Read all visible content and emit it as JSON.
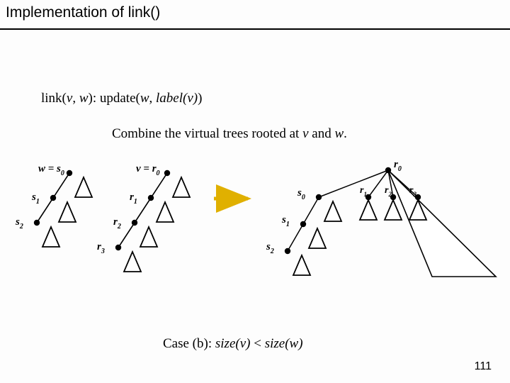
{
  "title_plain": "Implementation of ",
  "title_func": "link()",
  "line1": {
    "lhs": "link(",
    "v": "v",
    "sep1": ", ",
    "w": "w",
    "rhs1": "):  update(",
    "arg_w": "w",
    "sep2": ", ",
    "label_open": "label(",
    "arg_v": "v",
    "label_close": ")",
    "close": ")"
  },
  "line2": {
    "text1": "Combine the virtual trees rooted at ",
    "v": "v",
    "text2": "  and  ",
    "w": "w",
    "dot": "."
  },
  "caseb": {
    "label": "Case (b):  ",
    "sizev": "size(v)",
    "lt": " < ",
    "sizew": "size(w)"
  },
  "page": "111",
  "labels": {
    "w_s0": "w = s",
    "v_r0": "v = r",
    "s1": "s",
    "s2": "s",
    "r1": "r",
    "r2": "r",
    "r3": "r",
    "r0_right": "r",
    "s0b": "s",
    "s1b": "s",
    "s2b": "s",
    "r1b": "r",
    "r2b": "r",
    "r3b": "r"
  }
}
